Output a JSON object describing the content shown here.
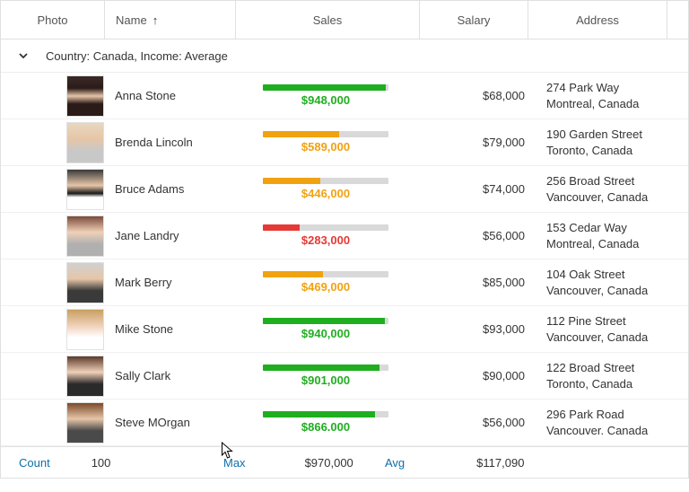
{
  "columns": {
    "photo": "Photo",
    "name": "Name",
    "sales": "Sales",
    "salary": "Salary",
    "address": "Address"
  },
  "sort": {
    "column": "Name",
    "icon": "↑"
  },
  "group": {
    "label": "Country: Canada, Income: Average"
  },
  "salesMax": 970000,
  "rows": [
    {
      "avatar": "av-a",
      "name": "Anna Stone",
      "sales": 948000,
      "salesText": "$948,000",
      "tier": "green",
      "salary": "$68,000",
      "addr1": "274 Park Way",
      "addr2": "Montreal, Canada"
    },
    {
      "avatar": "av-b",
      "name": "Brenda Lincoln",
      "sales": 589000,
      "salesText": "$589,000",
      "tier": "orange",
      "salary": "$79,000",
      "addr1": "190 Garden Street",
      "addr2": "Toronto, Canada"
    },
    {
      "avatar": "av-c",
      "name": "Bruce Adams",
      "sales": 446000,
      "salesText": "$446,000",
      "tier": "orange",
      "salary": "$74,000",
      "addr1": "256 Broad Street",
      "addr2": "Vancouver, Canada"
    },
    {
      "avatar": "av-d",
      "name": "Jane Landry",
      "sales": 283000,
      "salesText": "$283,000",
      "tier": "red",
      "salary": "$56,000",
      "addr1": "153 Cedar Way",
      "addr2": "Montreal, Canada"
    },
    {
      "avatar": "av-e",
      "name": "Mark Berry",
      "sales": 469000,
      "salesText": "$469,000",
      "tier": "orange",
      "salary": "$85,000",
      "addr1": "104 Oak Street",
      "addr2": "Vancouver, Canada"
    },
    {
      "avatar": "av-f",
      "name": "Mike Stone",
      "sales": 940000,
      "salesText": "$940,000",
      "tier": "green",
      "salary": "$93,000",
      "addr1": "112 Pine Street",
      "addr2": "Vancouver, Canada"
    },
    {
      "avatar": "av-g",
      "name": "Sally Clark",
      "sales": 901000,
      "salesText": "$901,000",
      "tier": "green",
      "salary": "$90,000",
      "addr1": "122 Broad Street",
      "addr2": "Toronto, Canada"
    },
    {
      "avatar": "av-h",
      "name": "Steve MOrgan",
      "sales": 866000,
      "salesText": "$866.000",
      "tier": "green",
      "salary": "$56,000",
      "addr1": "296 Park Road",
      "addr2": "Vancouver. Canada"
    }
  ],
  "footer": {
    "countLabel": "Count",
    "countValue": "100",
    "maxLabel": "Max",
    "maxValue": "$970,000",
    "avgLabel": "Avg",
    "avgValue": "$117,090"
  }
}
